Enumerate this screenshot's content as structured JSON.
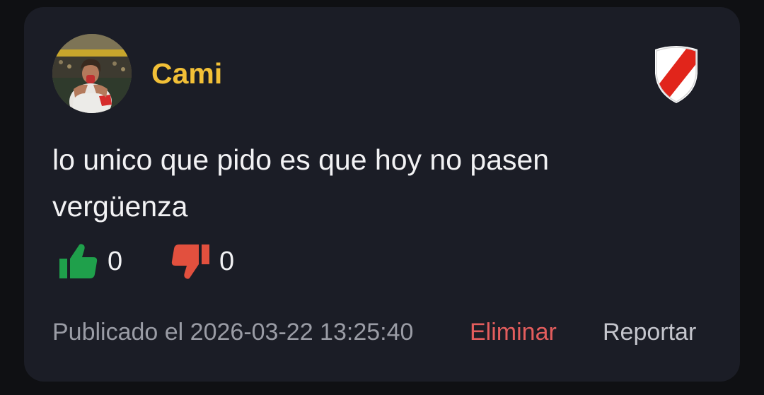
{
  "post": {
    "author": {
      "name": "Cami",
      "name_color": "#f2c037",
      "avatar_icon": "user-avatar-photo"
    },
    "team_badge": {
      "icon": "river-plate-shield-icon",
      "colors": [
        "#ffffff",
        "#e1251b"
      ]
    },
    "text": "lo unico que pido es que hoy no pasen vergüenza",
    "likes": {
      "icon": "thumbs-up-icon",
      "count": "0",
      "color": "#1fa04b"
    },
    "dislikes": {
      "icon": "thumbs-down-icon",
      "count": "0",
      "color": "#e2503e"
    },
    "footer": {
      "published": "Publicado el 2026-03-22 13:25:40",
      "delete_label": "Eliminar",
      "report_label": "Reportar"
    }
  },
  "colors": {
    "card_background": "#1b1d26",
    "page_background": "#0f1013"
  }
}
